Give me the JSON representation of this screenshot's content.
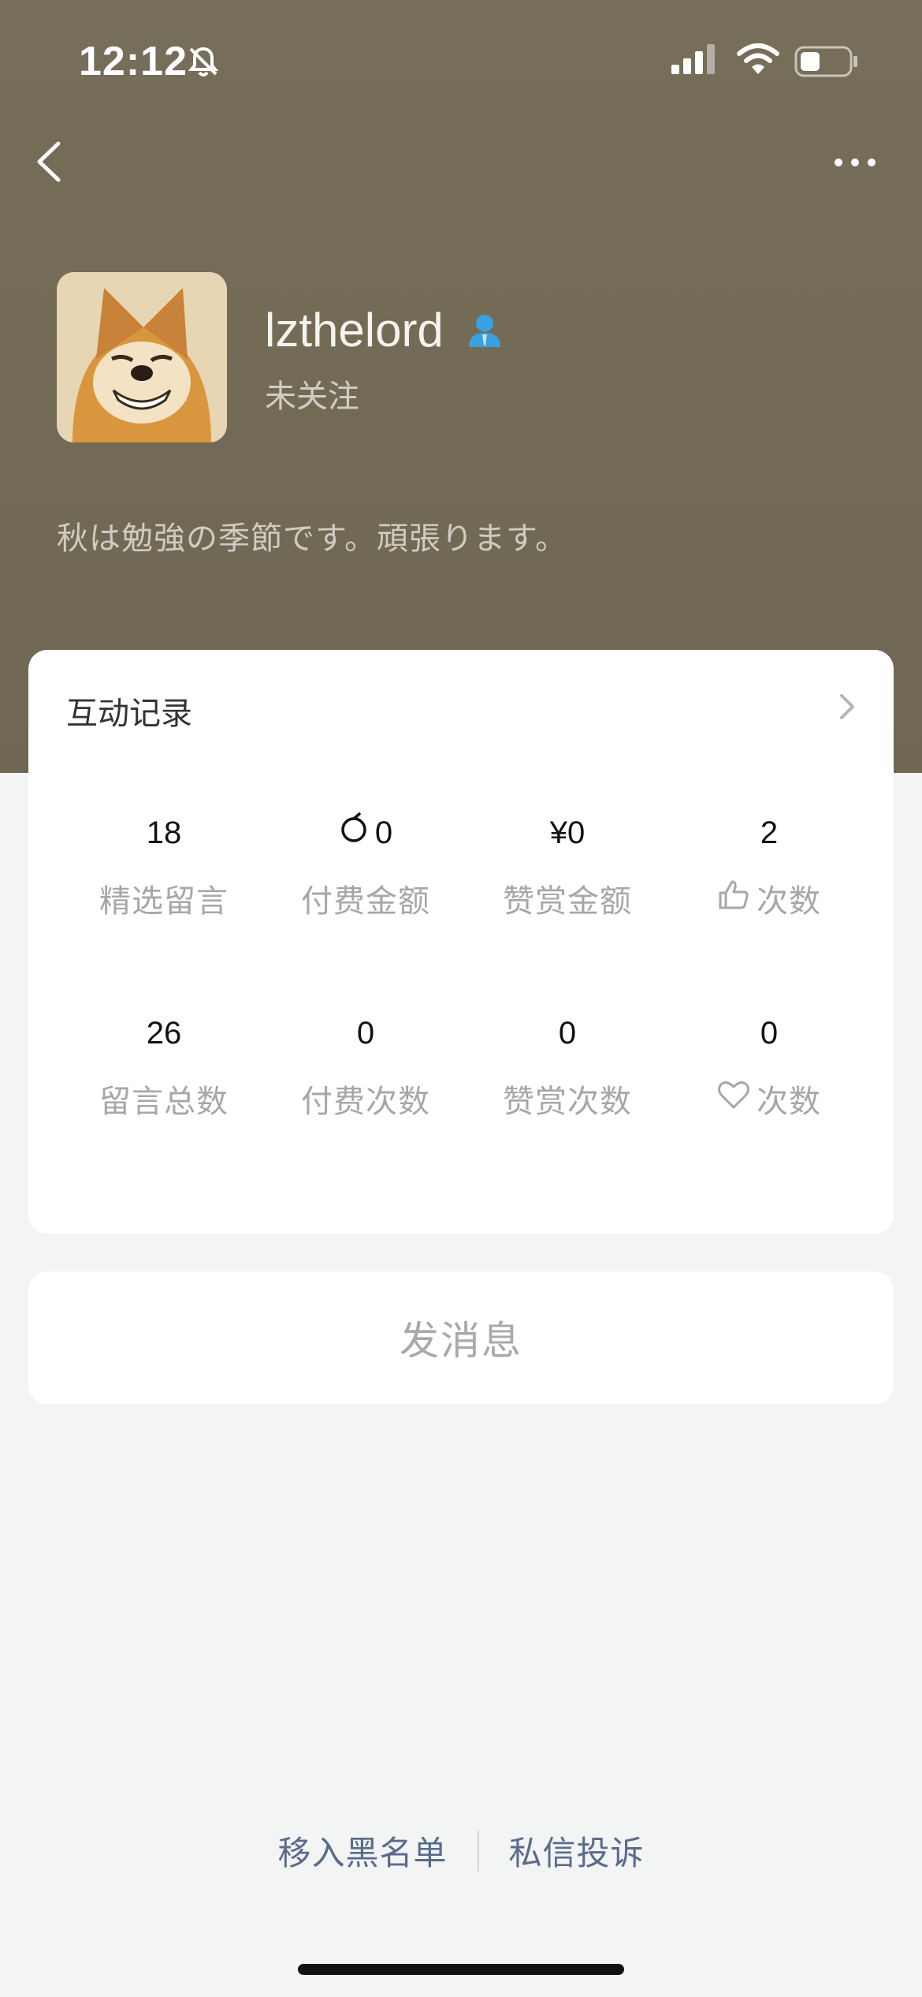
{
  "status_bar": {
    "time": "12:12"
  },
  "profile": {
    "username": "lzthelord",
    "follow_status": "未关注",
    "bio": "秋は勉強の季節です。頑張ります。"
  },
  "interaction": {
    "title": "互动记录",
    "stats": [
      {
        "value": "18",
        "label": "精选留言"
      },
      {
        "value": "0",
        "label": "付费金额",
        "icon": "coin-icon"
      },
      {
        "value": "¥0",
        "label": "赞赏金额"
      },
      {
        "value": "2",
        "label": "次数",
        "icon": "thumbs-up-icon"
      },
      {
        "value": "26",
        "label": "留言总数"
      },
      {
        "value": "0",
        "label": "付费次数"
      },
      {
        "value": "0",
        "label": "赞赏次数"
      },
      {
        "value": "0",
        "label": "次数",
        "icon": "heart-icon"
      }
    ]
  },
  "actions": {
    "send_message": "发消息"
  },
  "footer": {
    "blacklist": "移入黑名单",
    "report": "私信投诉"
  },
  "colors": {
    "header_bg": "#776e5a",
    "link": "#5a6b8c",
    "badge": "#3aa0e0"
  }
}
